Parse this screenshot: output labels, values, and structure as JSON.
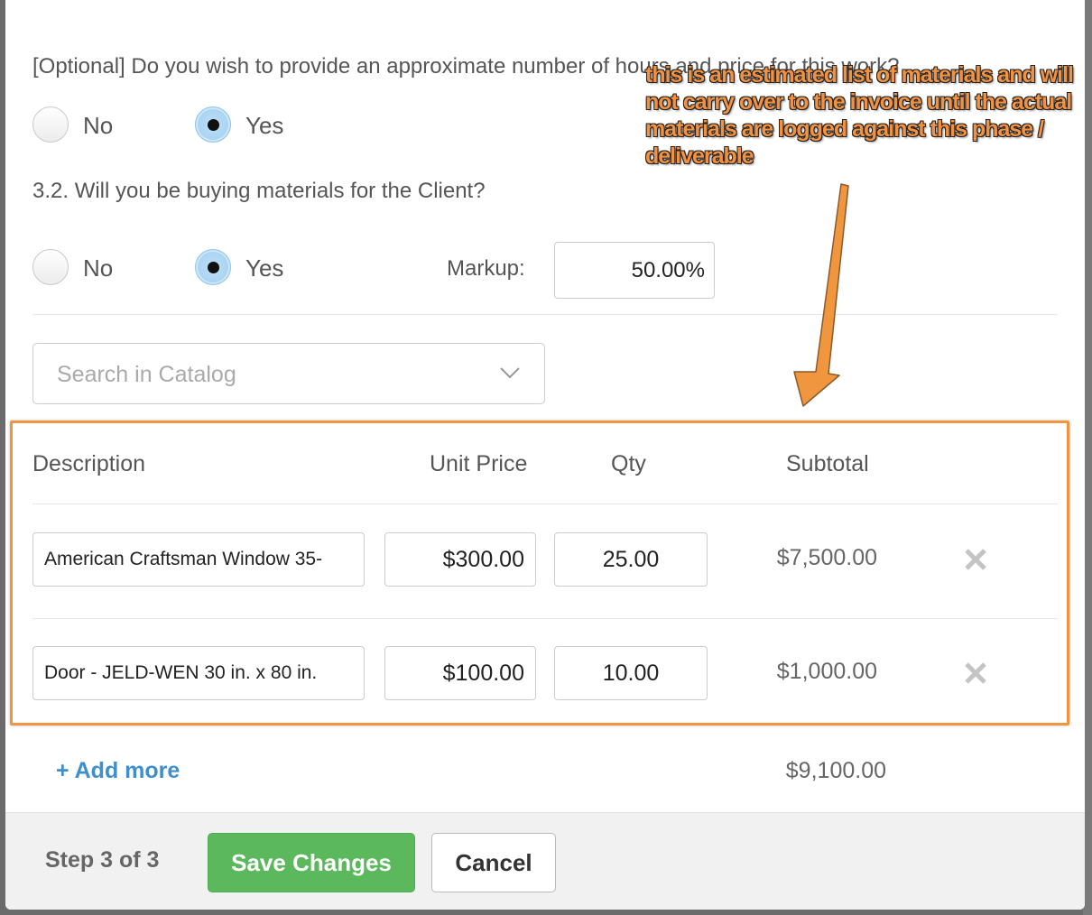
{
  "questions": {
    "q_optional": "[Optional] Do you wish to provide an approximate number of hours and price for this work?",
    "q_materials": "3.2. Will you be buying materials for the Client?"
  },
  "radios": {
    "no_label": "No",
    "yes_label": "Yes"
  },
  "markup": {
    "label": "Markup:",
    "value": "50.00%"
  },
  "search": {
    "placeholder": "Search in Catalog"
  },
  "table": {
    "headers": {
      "description": "Description",
      "unit_price": "Unit Price",
      "qty": "Qty",
      "subtotal": "Subtotal"
    },
    "rows": [
      {
        "description": "American Craftsman Window 35-",
        "unit_price": "$300.00",
        "qty": "25.00",
        "subtotal": "$7,500.00"
      },
      {
        "description": "Door - JELD-WEN 30 in. x 80 in.",
        "unit_price": "$100.00",
        "qty": "10.00",
        "subtotal": "$1,000.00"
      }
    ],
    "add_more": "+ Add more",
    "total": "$9,100.00"
  },
  "footer": {
    "step": "Step 3 of 3",
    "save_label": "Save Changes",
    "cancel_label": "Cancel"
  },
  "annotation": {
    "text": "this is an estimated list of materials and will not carry over to the invoice until the actual materials are logged against this phase / deliverable"
  },
  "colors": {
    "accent_orange": "#f0963f",
    "save_green": "#5cb85c",
    "link_blue": "#3f8fcf",
    "radio_selected": "#9ccdef"
  },
  "icons": {
    "dropdown": "chevron-down-icon",
    "remove": "close-icon"
  }
}
